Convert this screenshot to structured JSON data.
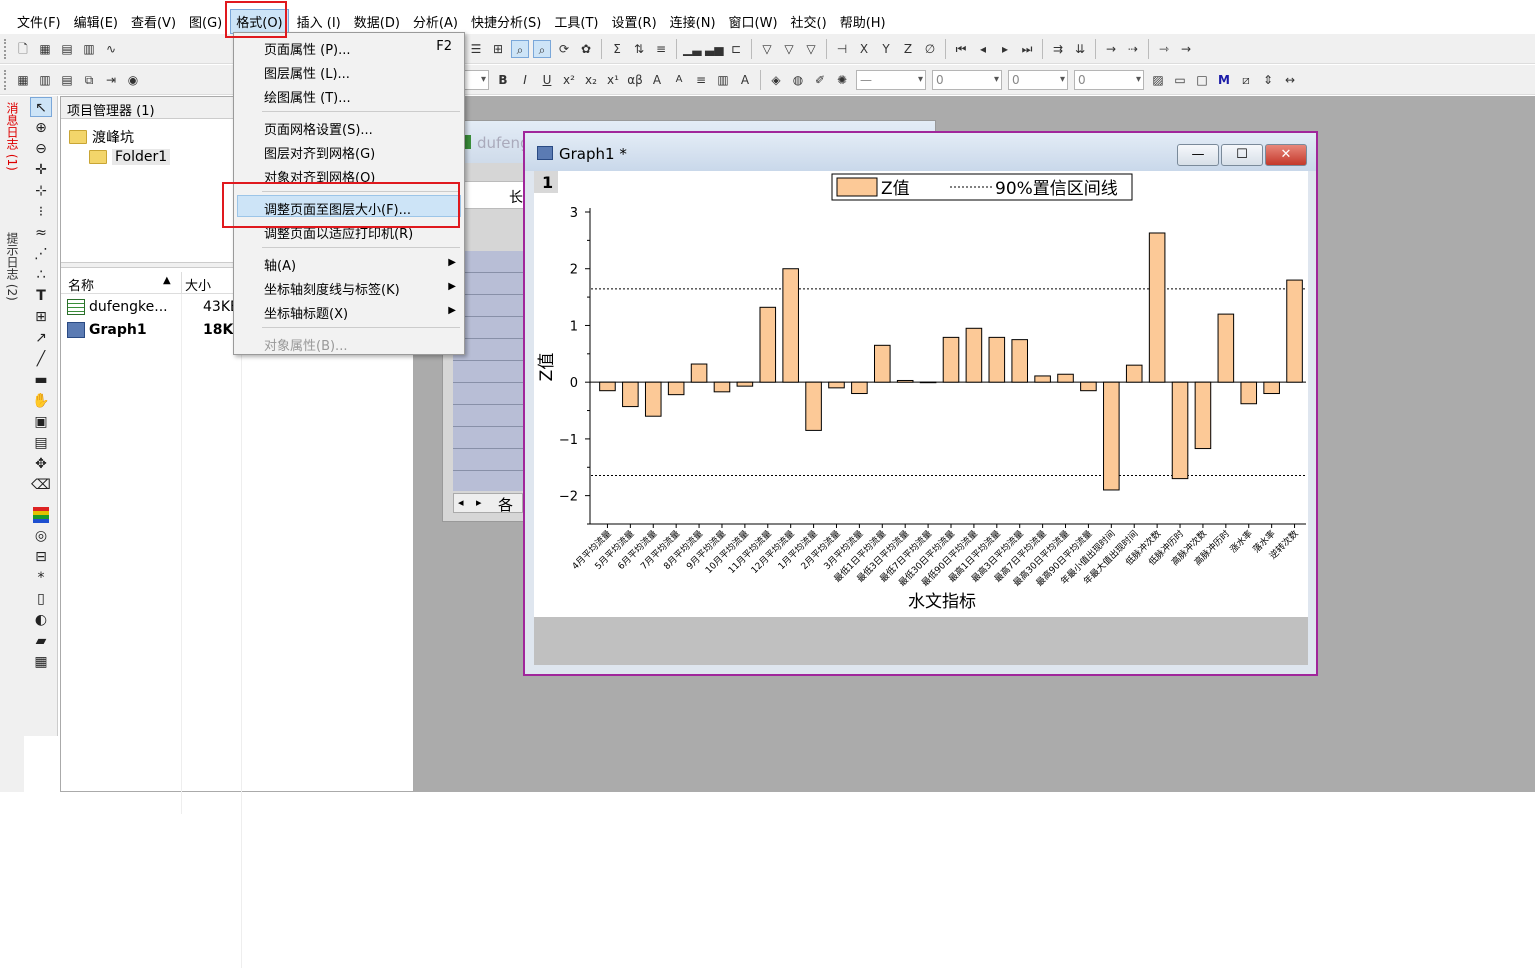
{
  "menubar": {
    "items": [
      "文件(F)",
      "编辑(E)",
      "查看(V)",
      "图(G)",
      "格式(O)",
      "插入 (I)",
      "数据(D)",
      "分析(A)",
      "快捷分析(S)",
      "工具(T)",
      "设置(R)",
      "连接(N)",
      "窗口(W)",
      "社交()",
      "帮助(H)"
    ],
    "active_index": 4
  },
  "toolbar2": {
    "combo1": "0",
    "combo2": "0",
    "combo3": "0",
    "combo4": "0",
    "bold": "B",
    "italic": "I",
    "underline": "U",
    "sup": "x²",
    "sub": "x₂",
    "supsub": "x¹",
    "greek": "αβ",
    "bigA": "A",
    "smallA": "A"
  },
  "left_strip": {
    "messages_log": "消息日志 (1)",
    "hints_log": "提示日志 (2)"
  },
  "project_manager": {
    "title": "项目管理器 (1)",
    "root": "渡峰坑",
    "folder": "Folder1",
    "columns": {
      "name": "名称",
      "size": "大小"
    },
    "files": [
      {
        "name": "dufengke...",
        "size": "43KB",
        "type": "workbook"
      },
      {
        "name": "Graph1",
        "size": "18KB",
        "type": "graph"
      }
    ]
  },
  "workbook_window": {
    "title": "dufeng",
    "col_label": "长",
    "sheet_tab": "各"
  },
  "format_menu": {
    "items": [
      {
        "label": "页面属性 (P)...",
        "shortcut": "F2"
      },
      {
        "label": "图层属性 (L)..."
      },
      {
        "label": "绘图属性 (T)..."
      },
      {
        "label": "页面网格设置(S)..."
      },
      {
        "label": "图层对齐到网格(G)"
      },
      {
        "label": "对象对齐到网格(O)"
      },
      {
        "label": "调整页面至图层大小(F)...",
        "highlighted": true
      },
      {
        "label": "调整页面以适应打印机(R)"
      },
      {
        "label": "轴(A)",
        "submenu": true
      },
      {
        "label": "坐标轴刻度线与标签(K)",
        "submenu": true
      },
      {
        "label": "坐标轴标题(X)",
        "submenu": true
      },
      {
        "label": "对象属性(B)...",
        "disabled": true
      }
    ]
  },
  "graph_window": {
    "title": "Graph1 *",
    "layer_label": "1",
    "min_btn": "—",
    "max_btn": "☐",
    "close_btn": "✕"
  },
  "chart_data": {
    "type": "bar",
    "xlabel": "水文指标",
    "ylabel": "Z值",
    "ylim": [
      -2.5,
      3
    ],
    "yticks": [
      -2,
      -1,
      0,
      1,
      2,
      3
    ],
    "ytick_labels": [
      "−2",
      "−1",
      "0",
      "1",
      "2",
      "3"
    ],
    "legend": {
      "bar_label": "Z值",
      "line_label": "90%置信区间线",
      "position": "top-center"
    },
    "confidence_lines": [
      1.645,
      -1.645
    ],
    "bar_color": "#fcc997",
    "categories": [
      "4月平均流量",
      "5月平均流量",
      "6月平均流量",
      "7月平均流量",
      "8月平均流量",
      "9月平均流量",
      "10月平均流量",
      "11月平均流量",
      "12月平均流量",
      "1月平均流量",
      "2月平均流量",
      "3月平均流量",
      "最低1日平均流量",
      "最低3日平均流量",
      "最低7日平均流量",
      "最低30日平均流量",
      "最低90日平均流量",
      "最高1日平均流量",
      "最高3日平均流量",
      "最高7日平均流量",
      "最高30日平均流量",
      "最高90日平均流量",
      "年最小值出现时间",
      "年最大值出现时间",
      "低脉冲次数",
      "低脉冲历时",
      "高脉冲次数",
      "高脉冲历时",
      "涨水率",
      "落水率",
      "逆转次数"
    ],
    "values": [
      -0.15,
      -0.43,
      -0.6,
      -0.22,
      0.32,
      -0.17,
      -0.07,
      1.32,
      2.0,
      -0.85,
      -0.1,
      -0.2,
      0.65,
      0.03,
      0.0,
      0.79,
      0.95,
      0.79,
      0.75,
      0.11,
      0.14,
      -0.15,
      -1.9,
      0.3,
      2.63,
      -1.7,
      -1.17,
      1.2,
      -0.38,
      -0.2,
      1.8
    ]
  }
}
